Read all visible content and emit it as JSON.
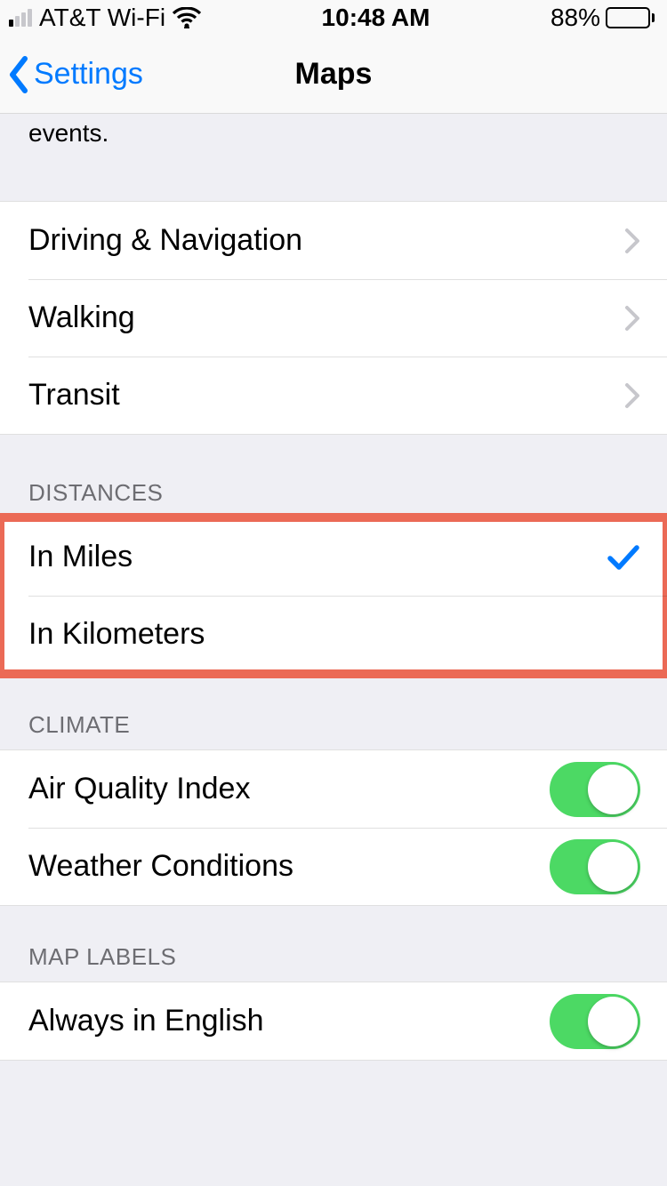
{
  "status": {
    "carrier": "AT&T Wi-Fi",
    "time": "10:48 AM",
    "battery_pct": "88%"
  },
  "nav": {
    "back_label": "Settings",
    "title": "Maps"
  },
  "footer_remnant": "events.",
  "group_nav": {
    "items": [
      {
        "label": "Driving & Navigation"
      },
      {
        "label": "Walking"
      },
      {
        "label": "Transit"
      }
    ]
  },
  "distances": {
    "header": "DISTANCES",
    "items": [
      {
        "label": "In Miles",
        "selected": true
      },
      {
        "label": "In Kilometers",
        "selected": false
      }
    ]
  },
  "climate": {
    "header": "CLIMATE",
    "items": [
      {
        "label": "Air Quality Index",
        "on": true
      },
      {
        "label": "Weather Conditions",
        "on": true
      }
    ]
  },
  "map_labels": {
    "header": "MAP LABELS",
    "items": [
      {
        "label": "Always in English",
        "on": true
      }
    ]
  },
  "cutoff_header": ""
}
